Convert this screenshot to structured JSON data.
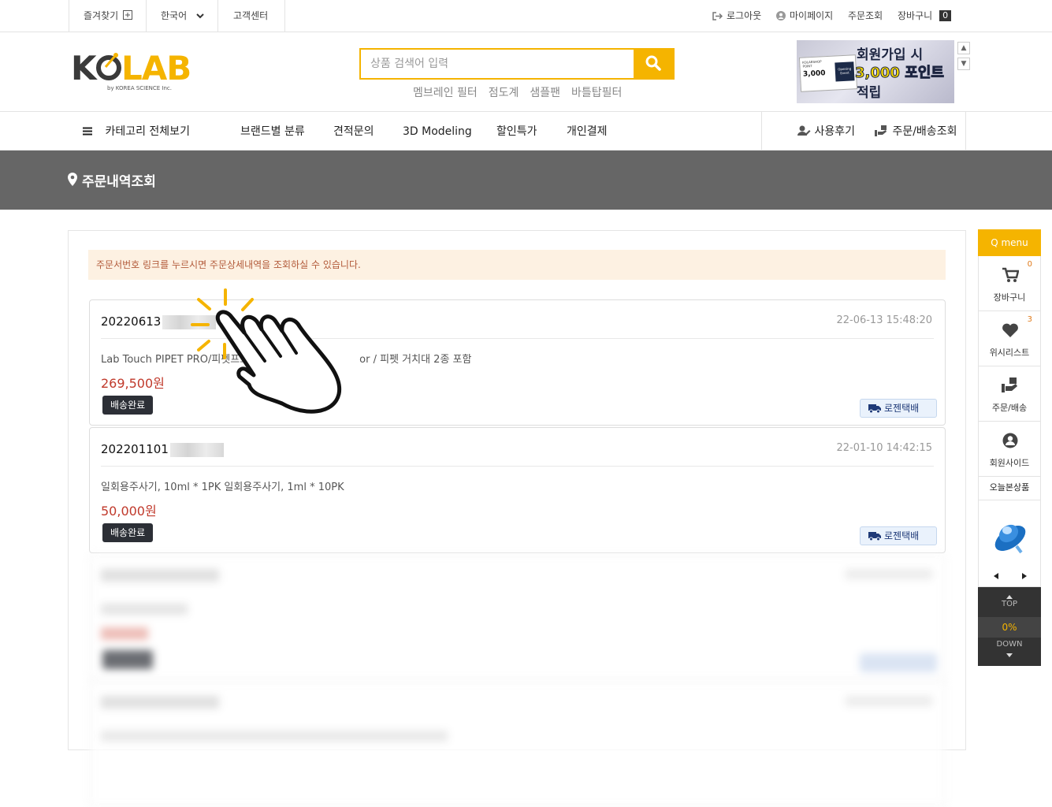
{
  "topbar": {
    "bookmark": "즐겨찾기",
    "language": "한국어",
    "support": "고객센터",
    "logout": "로그아웃",
    "mypage": "마이페이지",
    "order_lookup": "주문조회",
    "cart": "장바구니",
    "cart_count": "0"
  },
  "header": {
    "logo_text": "KOLAB",
    "logo_sub": "by KOREA SCIENCE Inc.",
    "search_placeholder": "상품 검색어 입력",
    "keywords": [
      "멤브레인 필터",
      "점도계",
      "샘플팬",
      "바틀탑필터"
    ],
    "banner": {
      "line1": "회원가입 시",
      "line2": "3,000 포인트",
      "line3": "적립",
      "card_small": "KOLABSHOP POINT",
      "card_value": "3,000",
      "card_event": "Opening Event"
    }
  },
  "nav": {
    "categories": "카테고리 전체보기",
    "items": [
      "브랜드별 분류",
      "견적문의",
      "3D Modeling",
      "할인특가",
      "개인결제"
    ],
    "reviews": "사용후기",
    "order_delivery": "주문/배송조회"
  },
  "page": {
    "title": "주문내역조회",
    "notice": "주문서번호 링크를 누르시면 주문상세내역을 조회하실 수 있습니다."
  },
  "orders": [
    {
      "number": "20220613",
      "date": "22-06-13 15:48:20",
      "items": "Lab Touch PIPET PRO/피펫프로",
      "items_tail": "or / 피펫 거치대 2종 포함",
      "price": "269,500원",
      "status": "배송완료",
      "courier": "로젠택배"
    },
    {
      "number": "202201101",
      "date": "22-01-10 14:42:15",
      "items": "일회용주사기, 10ml * 1PK 일회용주사기, 1ml * 10PK",
      "price": "50,000원",
      "status": "배송완료",
      "courier": "로젠택배"
    }
  ],
  "quick_menu": {
    "header": "Q menu",
    "cart_label": "장바구니",
    "cart_count": "0",
    "wishlist_label": "위시리스트",
    "wishlist_count": "3",
    "order_label": "주문/배송",
    "member_label": "회원사이드",
    "today_label": "오늘본상품",
    "top_label": "TOP",
    "scroll_pct": "0%",
    "down_label": "DOWN"
  },
  "colors": {
    "accent": "#f5b400",
    "title_band": "#666666",
    "price": "#c0392b",
    "notice_bg": "#fdf1e2"
  }
}
